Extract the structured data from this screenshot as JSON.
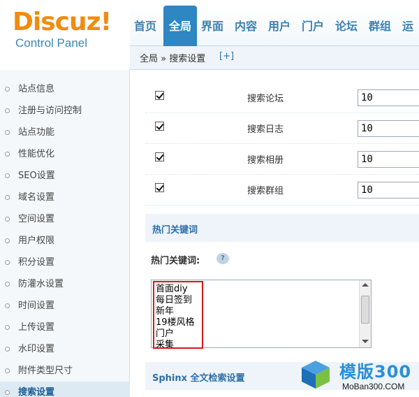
{
  "logo": {
    "brand": "Discuz!",
    "sub": "Control Panel"
  },
  "topnav": {
    "items": [
      {
        "label": "首页",
        "active": false
      },
      {
        "label": "全局",
        "active": true
      },
      {
        "label": "界面",
        "active": false
      },
      {
        "label": "内容",
        "active": false
      },
      {
        "label": "用户",
        "active": false
      },
      {
        "label": "门户",
        "active": false
      },
      {
        "label": "论坛",
        "active": false
      },
      {
        "label": "群组",
        "active": false
      },
      {
        "label": "运",
        "active": false
      }
    ]
  },
  "breadcrumb": {
    "text": "全局 » 搜索设置",
    "plus": "[+]"
  },
  "sidebar": {
    "items": [
      {
        "label": "站点信息"
      },
      {
        "label": "注册与访问控制"
      },
      {
        "label": "站点功能"
      },
      {
        "label": "性能优化"
      },
      {
        "label": "SEO设置"
      },
      {
        "label": "域名设置"
      },
      {
        "label": "空间设置"
      },
      {
        "label": "用户权限"
      },
      {
        "label": "积分设置"
      },
      {
        "label": "防灌水设置"
      },
      {
        "label": "时间设置"
      },
      {
        "label": "上传设置"
      },
      {
        "label": "水印设置"
      },
      {
        "label": "附件类型尺寸"
      },
      {
        "label": "搜索设置",
        "active": true
      }
    ]
  },
  "search_rows": [
    {
      "label": "搜索论坛",
      "checked": true,
      "value": "10"
    },
    {
      "label": "搜索日志",
      "checked": true,
      "value": "10"
    },
    {
      "label": "搜索相册",
      "checked": true,
      "value": "10"
    },
    {
      "label": "搜索群组",
      "checked": true,
      "value": "10"
    }
  ],
  "hot_section": {
    "title": "热门关键词"
  },
  "hot_keywords": {
    "label": "热门关键词:",
    "lines": [
      "首面diy",
      "每日签到",
      "新年",
      "19楼风格",
      "门户",
      "采集"
    ]
  },
  "sphinx_section": {
    "title": "Sphinx 全文检索设置"
  },
  "watermark": {
    "big": "模版300",
    "small": "MoBan300.COM"
  },
  "colors": {
    "accent": "#2e86c3",
    "highlight": "#d81818",
    "logo_orange": "#f08c10"
  }
}
